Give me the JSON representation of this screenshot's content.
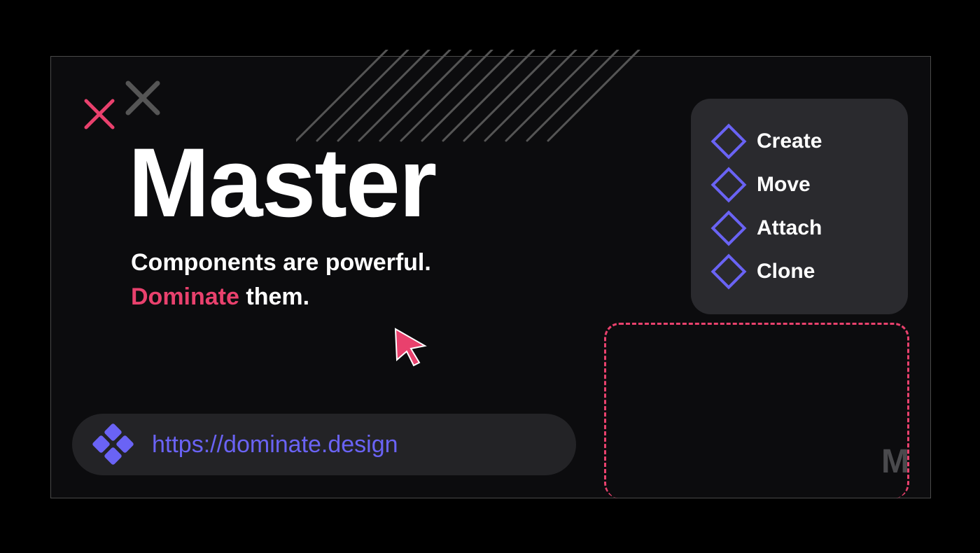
{
  "hero": {
    "title": "Master",
    "sub_line1": "Components are powerful.",
    "sub_accent": "Dominate",
    "sub_after": " them."
  },
  "menu": {
    "items": [
      {
        "label": "Create"
      },
      {
        "label": "Move"
      },
      {
        "label": "Attach"
      },
      {
        "label": "Clone"
      }
    ]
  },
  "url": "https://dominate.design",
  "brand_mark": "M",
  "colors": {
    "accent_pink": "#e9416d",
    "accent_indigo": "#6a63f5",
    "panel": "#2a2a2e",
    "pill": "#232326"
  }
}
